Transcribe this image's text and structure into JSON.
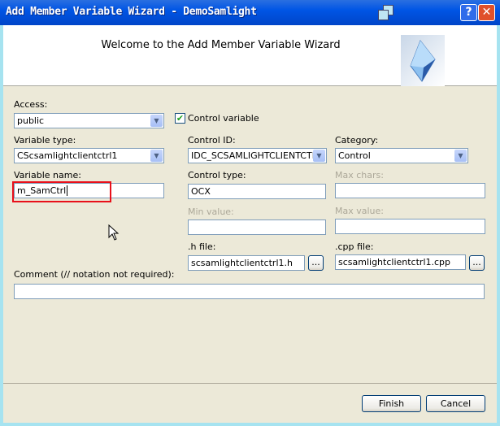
{
  "window": {
    "title": "Add Member Variable Wizard - DemoSamlight",
    "help": "?",
    "close": "✕"
  },
  "header": {
    "welcome": "Welcome to the Add Member Variable Wizard"
  },
  "form": {
    "access": {
      "label": "Access:",
      "value": "public"
    },
    "control_variable": {
      "label": "Control variable",
      "checked": true
    },
    "variable_type": {
      "label": "Variable type:",
      "value": "CScsamlightclientctrl1"
    },
    "control_id": {
      "label": "Control ID:",
      "value": "IDC_SCSAMLIGHTCLIENTCTRL"
    },
    "category": {
      "label": "Category:",
      "value": "Control"
    },
    "variable_name": {
      "label": "Variable name:",
      "value": "m_SamCtrl"
    },
    "control_type": {
      "label": "Control type:",
      "value": "OCX"
    },
    "max_chars": {
      "label": "Max chars:",
      "value": ""
    },
    "min_value": {
      "label": "Min value:",
      "value": ""
    },
    "max_value": {
      "label": "Max value:",
      "value": ""
    },
    "h_file": {
      "label": ".h file:",
      "value": "scsamlightclientctrl1.h",
      "browse": "..."
    },
    "cpp_file": {
      "label": ".cpp file:",
      "value": "scsamlightclientctrl1.cpp",
      "browse": "..."
    },
    "comment": {
      "label": "Comment (// notation not required):",
      "value": ""
    }
  },
  "buttons": {
    "finish": "Finish",
    "cancel": "Cancel"
  },
  "colors": {
    "highlight": "#e8101a",
    "titlebar": "#0055e5"
  }
}
